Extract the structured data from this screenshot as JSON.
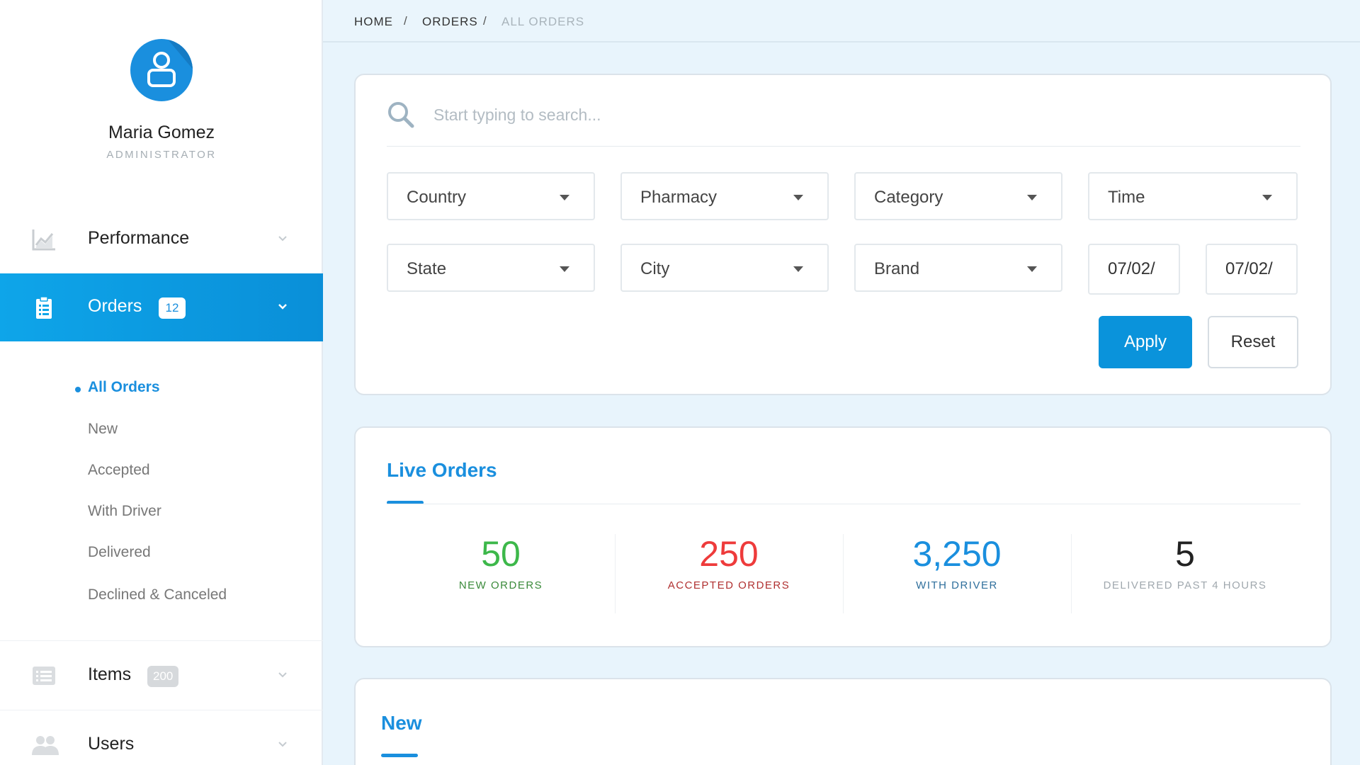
{
  "profile": {
    "name": "Maria Gomez",
    "role": "ADMINISTRATOR",
    "avatar_icon": "user-icon"
  },
  "nav": {
    "performance": {
      "label": "Performance",
      "icon": "line-chart-icon"
    },
    "orders": {
      "label": "Orders",
      "badge": "12",
      "icon": "clipboard-icon"
    },
    "items": {
      "label": "Items",
      "badge": "200",
      "icon": "list-icon"
    },
    "users": {
      "label": "Users",
      "icon": "users-icon"
    }
  },
  "orders_submenu": [
    "All Orders",
    "New",
    "Accepted",
    "With Driver",
    "Delivered",
    "Declined & Canceled"
  ],
  "breadcrumb": {
    "home": "HOME",
    "orders": "ORDERS",
    "current": "ALL ORDERS",
    "separator": "/"
  },
  "search": {
    "placeholder": "Start typing to search...",
    "value": ""
  },
  "filters": {
    "country": "Country",
    "pharmacy": "Pharmacy",
    "category": "Category",
    "time": "Time",
    "state": "State",
    "city": "City",
    "brand": "Brand",
    "date_from": "07/02/",
    "date_to": "07/02/"
  },
  "buttons": {
    "apply": "Apply",
    "reset": "Reset"
  },
  "live_orders": {
    "title": "Live Orders",
    "stats": [
      {
        "value": "50",
        "label": "NEW ORDERS",
        "color": "#3db84a"
      },
      {
        "value": "250",
        "label": "ACCEPTED ORDERS",
        "color": "#ee3b3b"
      },
      {
        "value": "3,250",
        "label": "WITH DRIVER",
        "color": "#1a8fde"
      },
      {
        "value": "5",
        "label": "DELIVERED PAST 4 HOURS",
        "color": "#222222"
      }
    ]
  },
  "new_section": {
    "title": "New"
  },
  "colors": {
    "accent": "#1a8fde",
    "background": "#e8f4fc"
  }
}
